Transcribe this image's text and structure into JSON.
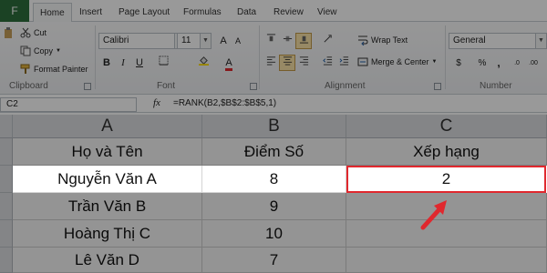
{
  "tabs": {
    "file": "F",
    "items": [
      "Home",
      "Insert",
      "Page Layout",
      "Formulas",
      "Data",
      "Review",
      "View"
    ],
    "active": "Home"
  },
  "clipboard": {
    "cut": "Cut",
    "copy": "Copy",
    "format_painter": "Format Painter",
    "label": "Clipboard"
  },
  "font": {
    "name": "Calibri",
    "size": "11",
    "label": "Font",
    "bold": "B",
    "italic": "I",
    "underline": "U",
    "font_color_glyph": "A"
  },
  "alignment": {
    "wrap_text": "Wrap Text",
    "merge_center": "Merge & Center",
    "label": "Alignment"
  },
  "number": {
    "format": "General",
    "currency": "$",
    "percent": "%",
    "comma": ",",
    "label": "Number"
  },
  "formula_bar": {
    "name_box": "C2",
    "fx": "fx",
    "formula": "=RANK(B2,$B$2:$B$5,1)"
  },
  "sheet": {
    "columns": [
      "A",
      "B",
      "C"
    ],
    "rows": [
      [
        "Họ và Tên",
        "Điểm Số",
        "Xếp hạng"
      ],
      [
        "Nguyễn Văn A",
        "8",
        "2"
      ],
      [
        "Trần Văn B",
        "9",
        ""
      ],
      [
        "Hoàng Thị C",
        "10",
        ""
      ],
      [
        "Lê Văn D",
        "7",
        ""
      ]
    ]
  },
  "colors": {
    "selection_border": "#e0282e",
    "arrow": "#e0282e",
    "file_tab": "#2d6e3d"
  }
}
